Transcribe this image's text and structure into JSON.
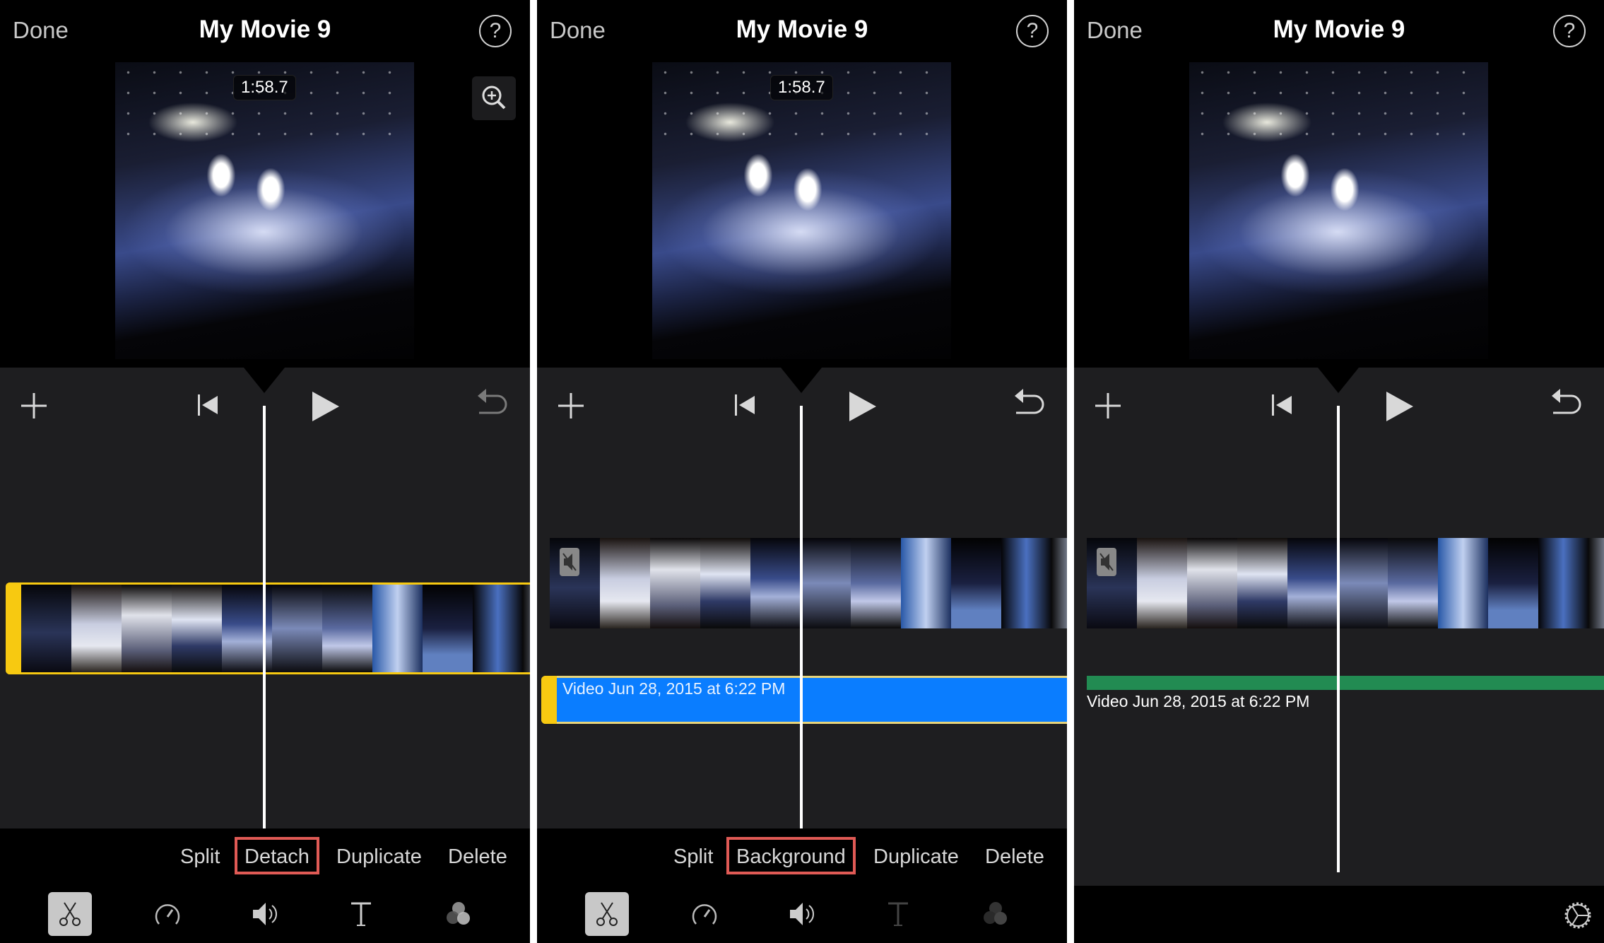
{
  "panels": [
    {
      "header": {
        "done_label": "Done",
        "title": "My Movie 9",
        "help_icon": "question-mark-icon"
      },
      "preview": {
        "timecode": "1:58.7",
        "zoom_icon": "zoom-in-icon"
      },
      "toolbar": {
        "add_icon": "plus-icon",
        "rewind_icon": "skip-back-icon",
        "play_icon": "play-icon",
        "undo_icon": "undo-icon",
        "undo_enabled": false
      },
      "timeline": {
        "clip_selected": true,
        "clip_color": "#f7c911"
      },
      "actions": [
        {
          "label": "Split",
          "highlighted": false
        },
        {
          "label": "Detach",
          "highlighted": true
        },
        {
          "label": "Duplicate",
          "highlighted": false
        },
        {
          "label": "Delete",
          "highlighted": false
        }
      ],
      "tabs": [
        {
          "name": "scissors-icon",
          "active": true
        },
        {
          "name": "speed-icon",
          "active": false
        },
        {
          "name": "volume-icon",
          "active": false
        },
        {
          "name": "title-icon",
          "active": false
        },
        {
          "name": "filter-icon",
          "active": false
        }
      ]
    },
    {
      "header": {
        "done_label": "Done",
        "title": "My Movie 9",
        "help_icon": "question-mark-icon"
      },
      "preview": {
        "timecode": "1:58.7"
      },
      "toolbar": {
        "add_icon": "plus-icon",
        "rewind_icon": "skip-back-icon",
        "play_icon": "play-icon",
        "undo_icon": "undo-icon",
        "undo_enabled": true
      },
      "timeline": {
        "video_muted": true,
        "audio_clip_label": "Video Jun 28, 2015 at 6:22 PM",
        "audio_clip_color": "#0a7dff"
      },
      "actions": [
        {
          "label": "Split",
          "highlighted": false
        },
        {
          "label": "Background",
          "highlighted": true
        },
        {
          "label": "Duplicate",
          "highlighted": false
        },
        {
          "label": "Delete",
          "highlighted": false
        }
      ],
      "tabs": [
        {
          "name": "scissors-icon",
          "active": true
        },
        {
          "name": "speed-icon",
          "active": false
        },
        {
          "name": "volume-icon",
          "active": false
        },
        {
          "name": "title-icon",
          "active": false,
          "disabled": true
        },
        {
          "name": "filter-icon",
          "active": false,
          "disabled": true
        }
      ]
    },
    {
      "header": {
        "done_label": "Done",
        "title": "My Movie 9",
        "help_icon": "question-mark-icon"
      },
      "toolbar": {
        "add_icon": "plus-icon",
        "rewind_icon": "skip-back-icon",
        "play_icon": "play-icon",
        "undo_icon": "undo-icon",
        "undo_enabled": true
      },
      "timeline": {
        "video_muted": true,
        "background_audio_label": "Video Jun 28, 2015 at 6:22 PM",
        "background_audio_color": "#228b52"
      },
      "footer": {
        "settings_icon": "gear-icon"
      }
    }
  ]
}
